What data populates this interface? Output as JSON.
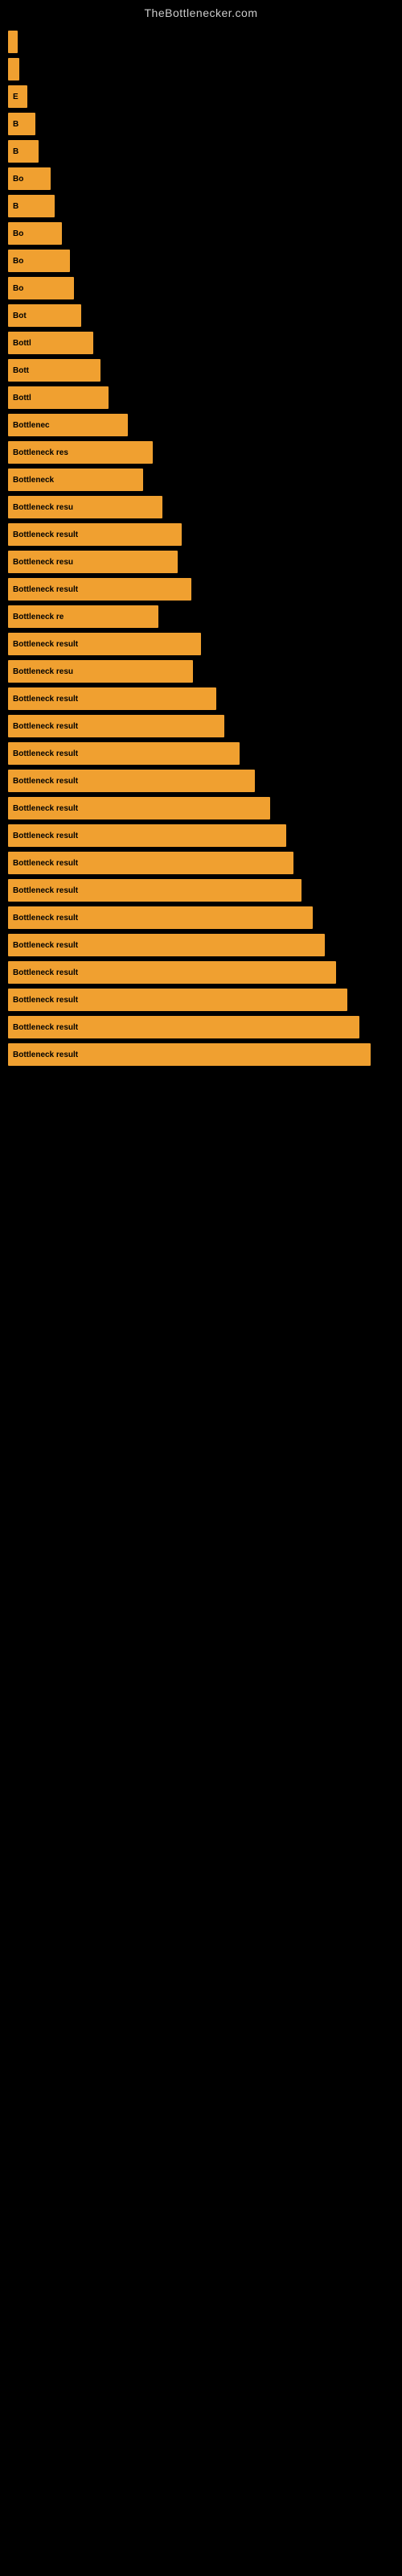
{
  "site": {
    "title": "TheBottlenecker.com"
  },
  "bars": [
    {
      "id": 1,
      "width": 4,
      "label": ""
    },
    {
      "id": 2,
      "width": 6,
      "label": ""
    },
    {
      "id": 3,
      "width": 10,
      "label": "E"
    },
    {
      "id": 4,
      "width": 14,
      "label": "B"
    },
    {
      "id": 5,
      "width": 16,
      "label": "B"
    },
    {
      "id": 6,
      "width": 22,
      "label": "Bo"
    },
    {
      "id": 7,
      "width": 24,
      "label": "B"
    },
    {
      "id": 8,
      "width": 28,
      "label": "Bo"
    },
    {
      "id": 9,
      "width": 32,
      "label": "Bo"
    },
    {
      "id": 10,
      "width": 34,
      "label": "Bo"
    },
    {
      "id": 11,
      "width": 38,
      "label": "Bot"
    },
    {
      "id": 12,
      "width": 44,
      "label": "Bottl"
    },
    {
      "id": 13,
      "width": 48,
      "label": "Bott"
    },
    {
      "id": 14,
      "width": 52,
      "label": "Bottl"
    },
    {
      "id": 15,
      "width": 62,
      "label": "Bottlenec"
    },
    {
      "id": 16,
      "width": 75,
      "label": "Bottleneck res"
    },
    {
      "id": 17,
      "width": 70,
      "label": "Bottleneck"
    },
    {
      "id": 18,
      "width": 80,
      "label": "Bottleneck resu"
    },
    {
      "id": 19,
      "width": 90,
      "label": "Bottleneck result"
    },
    {
      "id": 20,
      "width": 88,
      "label": "Bottleneck resu"
    },
    {
      "id": 21,
      "width": 95,
      "label": "Bottleneck result"
    },
    {
      "id": 22,
      "width": 78,
      "label": "Bottleneck re"
    },
    {
      "id": 23,
      "width": 100,
      "label": "Bottleneck result"
    },
    {
      "id": 24,
      "width": 96,
      "label": "Bottleneck resu"
    },
    {
      "id": 25,
      "width": 108,
      "label": "Bottleneck result"
    },
    {
      "id": 26,
      "width": 112,
      "label": "Bottleneck result"
    },
    {
      "id": 27,
      "width": 120,
      "label": "Bottleneck result"
    },
    {
      "id": 28,
      "width": 128,
      "label": "Bottleneck result"
    },
    {
      "id": 29,
      "width": 136,
      "label": "Bottleneck result"
    },
    {
      "id": 30,
      "width": 144,
      "label": "Bottleneck result"
    },
    {
      "id": 31,
      "width": 148,
      "label": "Bottleneck result"
    },
    {
      "id": 32,
      "width": 152,
      "label": "Bottleneck result"
    },
    {
      "id": 33,
      "width": 158,
      "label": "Bottleneck result"
    },
    {
      "id": 34,
      "width": 164,
      "label": "Bottleneck result"
    },
    {
      "id": 35,
      "width": 170,
      "label": "Bottleneck result"
    },
    {
      "id": 36,
      "width": 176,
      "label": "Bottleneck result"
    },
    {
      "id": 37,
      "width": 182,
      "label": "Bottleneck result"
    },
    {
      "id": 38,
      "width": 188,
      "label": "Bottleneck result"
    }
  ]
}
